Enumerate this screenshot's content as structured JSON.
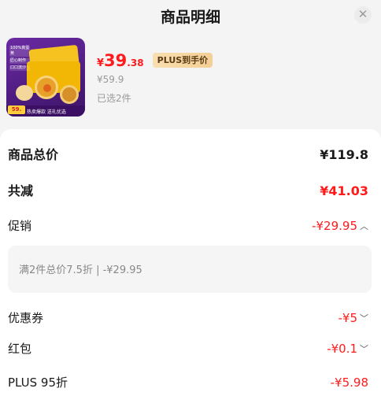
{
  "header": {
    "title": "商品明细",
    "close_icon": "close-icon"
  },
  "product": {
    "image_icon": "product-thumbnail",
    "thumb_labels": [
      "100%真蛋黄",
      "匠心制作",
      "口口流沙"
    ],
    "thumb_price_chip": "59.",
    "thumb_badge": "热卖爆款 送礼优选",
    "price_symbol": "¥",
    "price_int": "39",
    "price_dec": ".38",
    "plus_tag": "PLUS到手价",
    "original_price": "¥59.9",
    "selected_count": "已选2件"
  },
  "breakdown": {
    "total": {
      "label": "商品总价",
      "value": "¥119.8"
    },
    "discount_total": {
      "label": "共减",
      "value": "¥41.03"
    },
    "promotion": {
      "label": "促销",
      "value": "-¥29.95",
      "chevron": "chevron-up-icon"
    },
    "promotion_detail": "满2件总价7.5折 | -¥29.95",
    "coupon": {
      "label": "优惠券",
      "value": "-¥5",
      "chevron": "chevron-down-icon"
    },
    "red_packet": {
      "label": "红包",
      "value": "-¥0.1",
      "chevron": "chevron-down-icon"
    },
    "plus": {
      "label": "PLUS 95折",
      "value": "-¥5.98"
    }
  },
  "colors": {
    "accent_red": "#ff1b1b",
    "plus_gold": "#f4cf95",
    "panel_bg": "#ffffff",
    "page_bg": "#f4f4f4"
  }
}
